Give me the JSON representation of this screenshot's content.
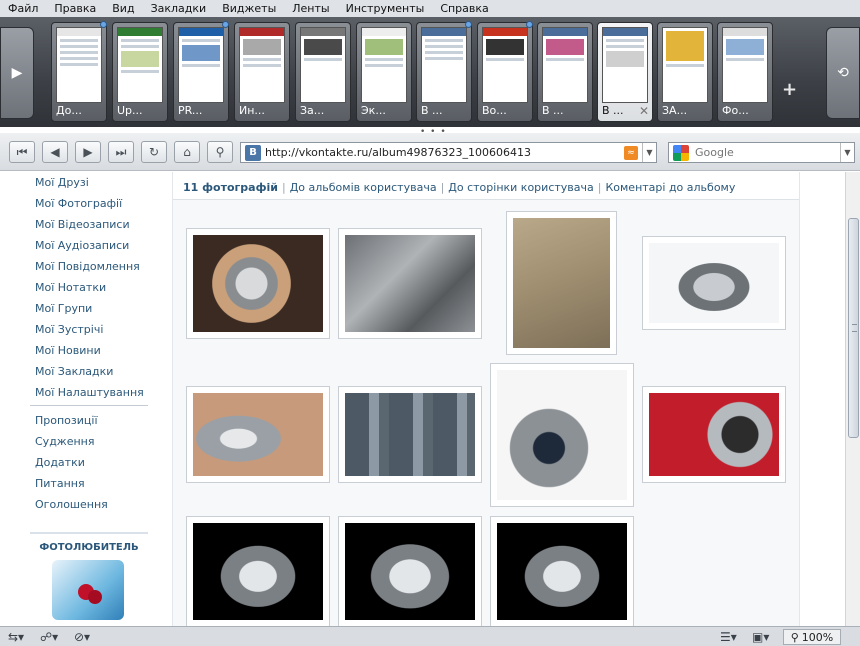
{
  "menu": [
    "Файл",
    "Правка",
    "Вид",
    "Закладки",
    "Виджеты",
    "Ленты",
    "Инструменты",
    "Справка"
  ],
  "tabs": [
    {
      "label": "До..."
    },
    {
      "label": "Up..."
    },
    {
      "label": "PR..."
    },
    {
      "label": "Ин..."
    },
    {
      "label": "За..."
    },
    {
      "label": "Эк..."
    },
    {
      "label": "В ..."
    },
    {
      "label": "Во..."
    },
    {
      "label": "В ..."
    },
    {
      "label": "В ..."
    },
    {
      "label": "ЗА..."
    },
    {
      "label": "Фо..."
    }
  ],
  "address": {
    "url": "http://vkontakte.ru/album49876323_100606413",
    "favicon": "B"
  },
  "search": {
    "placeholder": "Google"
  },
  "sidebar": {
    "links": [
      "Мої Друзі",
      "Мої Фотографії",
      "Мої Відеозаписи",
      "Мої Аудіозаписи",
      "Мої Повідомлення",
      "Мої Нотатки",
      "Мої Групи",
      "Мої Зустрічі",
      "Мої Новини",
      "Мої Закладки",
      "Мої Налаштування"
    ],
    "links2": [
      "Пропозиції",
      "Судження",
      "Додатки",
      "Питання",
      "Оголошення"
    ],
    "promo_title": "ФОТОЛЮБИТЕЛЬ"
  },
  "crumbs": {
    "count": "11 фотографій",
    "link1": "До альбомів користувача",
    "link2": "До сторінки користувача",
    "link3": "Коментарі до альбому"
  },
  "statusbar": {
    "zoom": "100%"
  },
  "icons": [
    "panel-toggle-icon",
    "rewind-icon",
    "back-icon",
    "forward-icon",
    "fast-forward-icon",
    "reload-icon",
    "home-icon",
    "key-icon",
    "rss-icon",
    "google-icon",
    "plus-icon",
    "trash-icon",
    "zoom-icon"
  ]
}
